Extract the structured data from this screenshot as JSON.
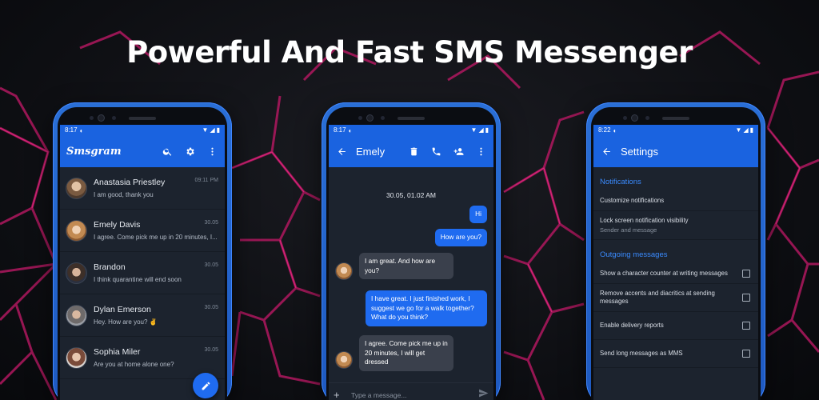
{
  "headline": "Powerful And Fast SMS Messenger",
  "colors": {
    "accent": "#1a63e0",
    "bubble_out": "#1f6bf0",
    "bubble_in": "#3a404c",
    "section": "#3a8bff",
    "background_lines": "#c4196f"
  },
  "phone1": {
    "time": "8:17",
    "app_title": "Smsgram",
    "icons": [
      "search-icon",
      "gear-icon",
      "more-vert-icon"
    ],
    "conversations": [
      {
        "name": "Anastasia Priestley",
        "preview": "I am good, thank you",
        "time": "09:11 PM"
      },
      {
        "name": "Emely Davis",
        "preview": "I agree. Come pick me up in 20 minutes, I...",
        "time": "30.05"
      },
      {
        "name": "Brandon",
        "preview": "I think quarantine will end soon",
        "time": "30.05"
      },
      {
        "name": "Dylan Emerson",
        "preview": "Hey. How are you? ✌",
        "time": "30.05"
      },
      {
        "name": "Sophia Miler",
        "preview": "Are you at home alone one?",
        "time": "30.05"
      }
    ]
  },
  "phone2": {
    "time": "8:17",
    "contact": "Emely",
    "date": "30.05, 01.02 AM",
    "messages": [
      {
        "dir": "out",
        "text": "Hi"
      },
      {
        "dir": "out",
        "text": "How are you?"
      },
      {
        "dir": "in",
        "text": "I am great. And how are you?"
      },
      {
        "dir": "out",
        "text": "I have great. I just finished work, I suggest we go for a walk together? What do you think?"
      },
      {
        "dir": "in",
        "text": "I agree. Come pick me up in 20 minutes, I will get dressed"
      }
    ],
    "composer_placeholder": "Type a message..."
  },
  "phone3": {
    "time": "8:22",
    "title": "Settings",
    "sections": [
      {
        "header": "Notifications"
      },
      {
        "header": "Outgoing messages"
      }
    ],
    "items": [
      {
        "title": "Customize notifications",
        "subtitle": ""
      },
      {
        "title": "Lock screen notification visibility",
        "subtitle": "Sender and message"
      },
      {
        "title": "Show a character counter at writing messages",
        "checked": false
      },
      {
        "title": "Remove accents and diacritics at sending messages",
        "checked": false
      },
      {
        "title": "Enable delivery reports",
        "checked": false
      },
      {
        "title": "Send long messages as MMS",
        "checked": false
      }
    ]
  }
}
